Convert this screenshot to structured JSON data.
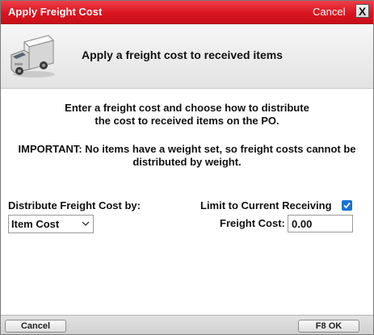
{
  "window": {
    "title": "Apply Freight Cost",
    "cancel_label": "Cancel",
    "close_glyph": "X"
  },
  "header": {
    "icon": "truck-icon",
    "title": "Apply a freight cost to received items"
  },
  "instructions": {
    "line1": "Enter a freight cost and choose how to distribute",
    "line2": "the cost to received items on the PO."
  },
  "important": {
    "line1": "IMPORTANT: No items have a weight set, so freight costs cannot be",
    "line2": "distributed by weight."
  },
  "form": {
    "distribute_label": "Distribute Freight Cost by:",
    "distribute_value": "Item Cost",
    "limit_label": "Limit to Current Receiving",
    "limit_checked": true,
    "freight_label": "Freight Cost:",
    "freight_value": "0.00"
  },
  "footer": {
    "cancel_label": "Cancel",
    "ok_label": "F8 OK"
  },
  "colors": {
    "titlebar": "#d9141f",
    "checkbox": "#1a73d2"
  }
}
